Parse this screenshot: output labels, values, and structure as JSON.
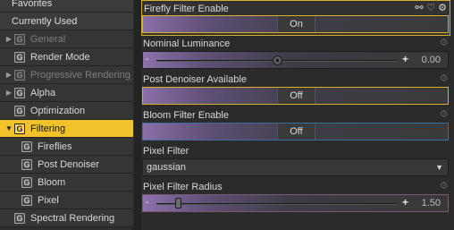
{
  "sidebar": {
    "favorites": "Favorites",
    "currently_used": "Currently Used",
    "items": [
      {
        "label": "General",
        "disabled": true,
        "arrow": "▶",
        "icon": "G"
      },
      {
        "label": "Render Mode",
        "disabled": false,
        "arrow": "",
        "icon": "G"
      },
      {
        "label": "Progressive Rendering",
        "disabled": true,
        "arrow": "▶",
        "icon": "G"
      },
      {
        "label": "Alpha",
        "disabled": false,
        "arrow": "▶",
        "icon": "G"
      },
      {
        "label": "Optimization",
        "disabled": false,
        "arrow": "",
        "icon": "G"
      },
      {
        "label": "Filtering",
        "disabled": false,
        "arrow": "▼",
        "icon": "G",
        "selected": true
      },
      {
        "label": "Fireflies",
        "sub": true,
        "icon": "G"
      },
      {
        "label": "Post Denoiser",
        "sub": true,
        "icon": "G"
      },
      {
        "label": "Bloom",
        "sub": true,
        "icon": "G"
      },
      {
        "label": "Pixel",
        "sub": true,
        "icon": "G"
      },
      {
        "label": "Spectral Rendering",
        "disabled": false,
        "arrow": "",
        "icon": "G"
      }
    ]
  },
  "properties": {
    "firefly": {
      "label": "Firefly Filter Enable",
      "value": "On"
    },
    "luminance": {
      "label": "Nominal Luminance",
      "minus": "-",
      "plus": "+",
      "value": "0.00",
      "fraction": 0.5
    },
    "post_denoiser": {
      "label": "Post Denoiser Available",
      "value": "Off"
    },
    "bloom": {
      "label": "Bloom Filter Enable",
      "value": "Off"
    },
    "pixel_filter": {
      "label": "Pixel Filter",
      "value": "gaussian",
      "caret": "▼"
    },
    "pixel_radius": {
      "label": "Pixel Filter Radius",
      "minus": "-",
      "plus": "+",
      "value": "1.50",
      "fraction": 0.09
    }
  },
  "icons": {
    "gear": "⚙",
    "link": "⚯",
    "heart": "♡"
  },
  "colors": {
    "selected": "#f2c22a",
    "highlight_border": "#d8b02a",
    "gradient_purple": "#8a6fa8"
  }
}
